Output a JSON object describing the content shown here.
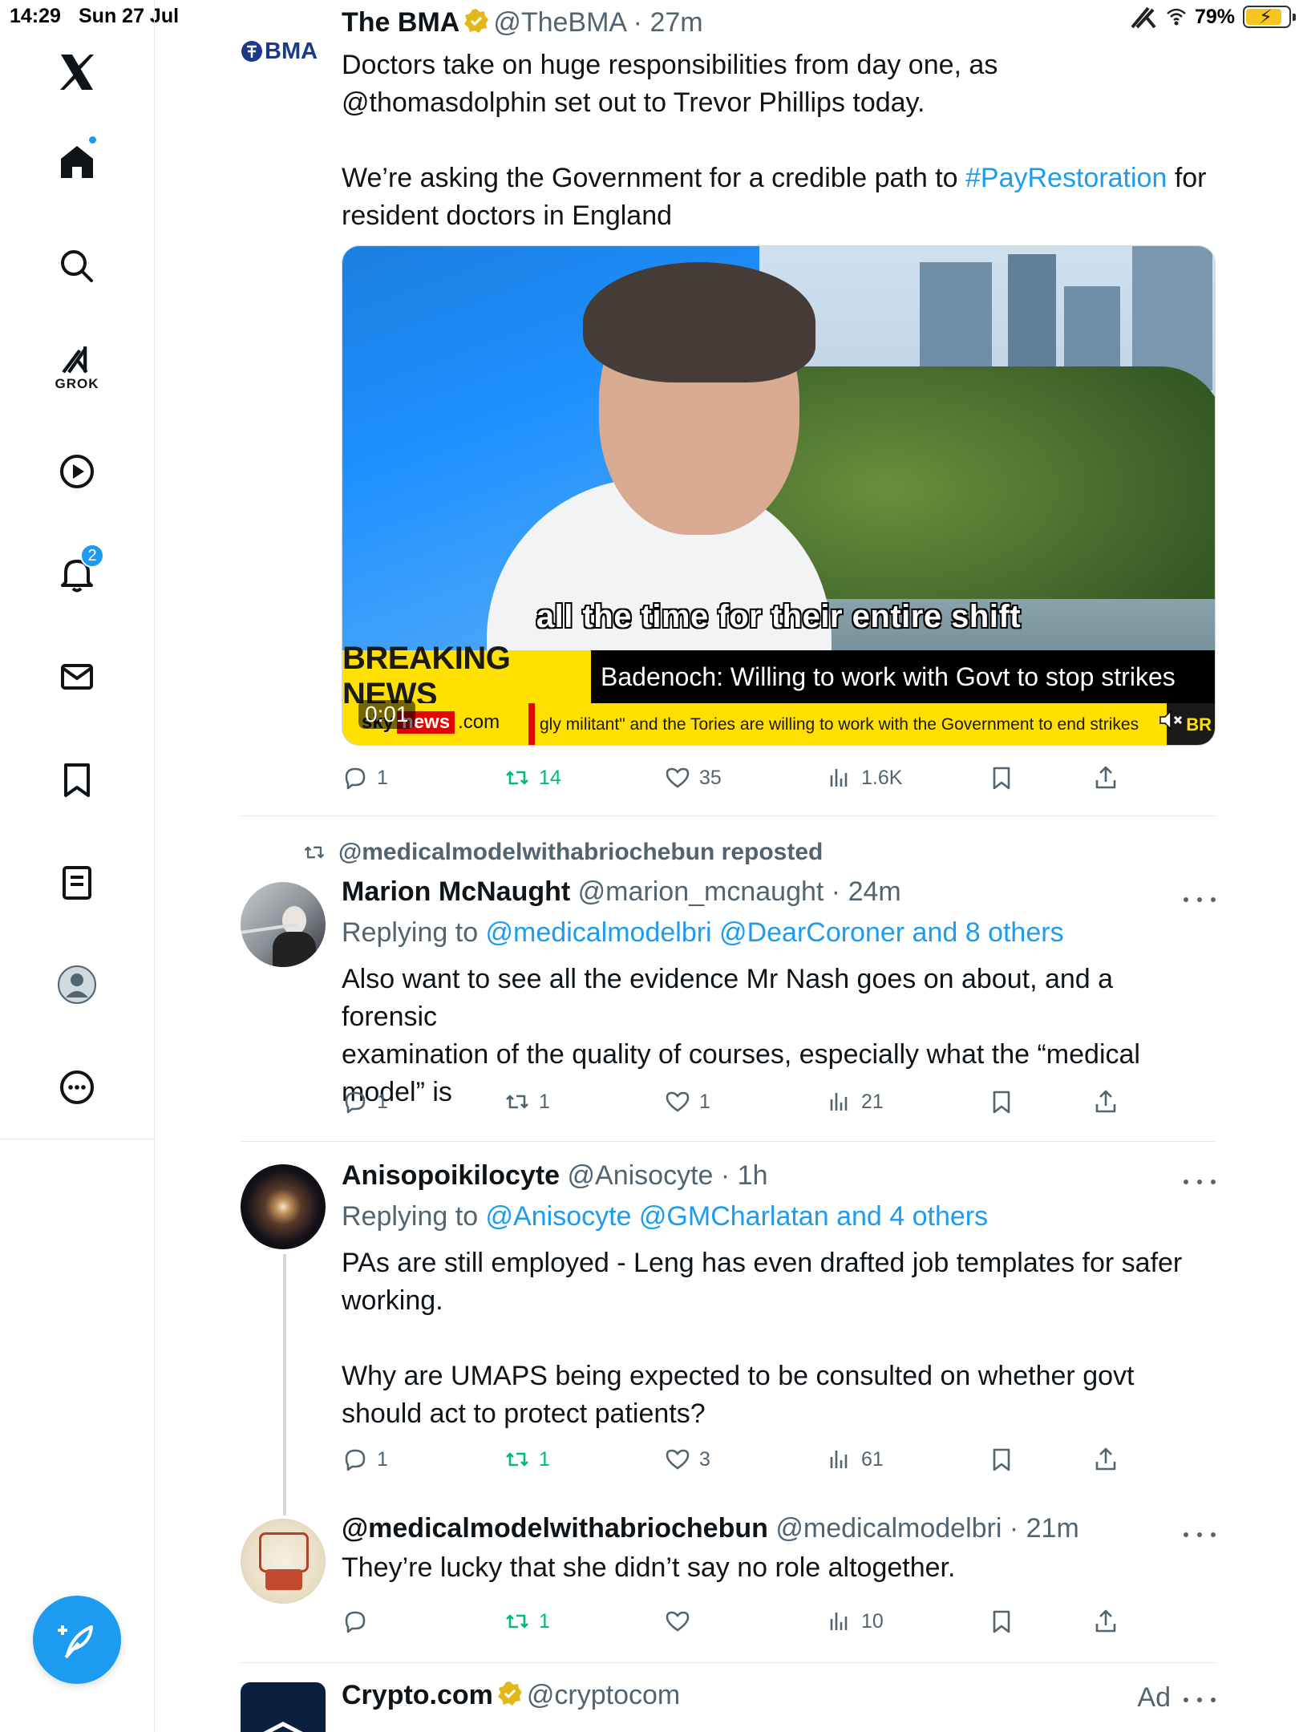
{
  "status_bar": {
    "time": "14:29",
    "date": "Sun 27 Jul",
    "battery": "79%",
    "battery_level": 0.79
  },
  "sidebar": {
    "items": [
      {
        "name": "x-logo"
      },
      {
        "name": "home"
      },
      {
        "name": "search"
      },
      {
        "name": "grok",
        "label": "GROK"
      },
      {
        "name": "video"
      },
      {
        "name": "notifications",
        "badge": "2"
      },
      {
        "name": "messages"
      },
      {
        "name": "bookmarks"
      },
      {
        "name": "lists"
      },
      {
        "name": "profile"
      },
      {
        "name": "more"
      }
    ]
  },
  "tweets": [
    {
      "name": "The BMA",
      "handle": "@TheBMA",
      "time": "27m",
      "avatar_text": "BMA",
      "text_1": "Doctors take on huge responsibilities from day one, as\n@thomasdolphin set out to Trevor Phillips today.\n\nWe’re asking the Government for a credible path to ",
      "hashtag": "#PayRestoration",
      "text_2": " for\nresident doctors in England",
      "video": {
        "subtitle": "all the time for their entire shift",
        "ticker_label": "BREAKING NEWS",
        "ticker_text": "Badenoch: Willing to work with Govt to stop strikes",
        "crawl_logo_1": "sky",
        "crawl_logo_2": "news",
        "crawl_logo_3": ".com",
        "crawl_text": "gly militant\" and the Tories are willing to work with the Government to end strikes",
        "crawl_end": "BR",
        "time": "0:01"
      },
      "actions": {
        "replies": "1",
        "reposts": "14",
        "likes": "35",
        "views": "1.6K"
      }
    },
    {
      "repost_label": "@medicalmodelwithabriochebun reposted",
      "name": "Marion McNaught",
      "handle": "@marion_mcnaught",
      "time": "24m",
      "replying_prefix": "Replying to ",
      "replying_to": "@medicalmodelbri @DearCoroner and 8 others",
      "text": "Also want to see all the evidence Mr Nash goes on about, and a forensic\nexamination of the quality of courses, especially what the “medical\nmodel” is",
      "actions": {
        "replies": "1",
        "reposts": "1",
        "likes": "1",
        "views": "21"
      }
    },
    {
      "name": "Anisopoikilocyte",
      "handle": "@Anisocyte",
      "time": "1h",
      "replying_prefix": "Replying to ",
      "replying_to": "@Anisocyte @GMCharlatan and 4 others",
      "text": "PAs are still employed - Leng has even drafted job templates for safer\nworking.\n\nWhy are UMAPS being expected to be consulted on whether govt\nshould act to protect patients?",
      "actions": {
        "replies": "1",
        "reposts": "1",
        "likes": "3",
        "views": "61"
      }
    },
    {
      "name": "@medicalmodelwithabriochebun",
      "handle": "@medicalmodelbri",
      "time": "21m",
      "text": "They’re lucky that she didn’t say no role altogether.",
      "actions": {
        "replies": "",
        "reposts": "1",
        "likes": "",
        "views": "10"
      }
    },
    {
      "name": "Crypto.com",
      "handle": "@cryptocom",
      "ad_label": "Ad"
    }
  ],
  "colors": {
    "accent": "#1d9bf0",
    "repost_green": "#00ba7c",
    "muted": "#536471",
    "text": "#0f1419"
  }
}
